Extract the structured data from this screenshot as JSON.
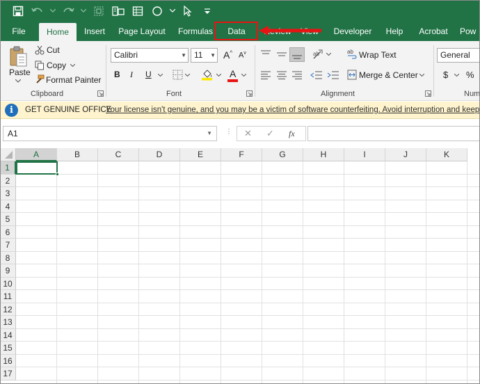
{
  "qat": {
    "icons": [
      "save-icon",
      "undo-icon",
      "redo-icon",
      "select-all-icon",
      "camera-icon",
      "form-icon",
      "shape-icon",
      "select-objects-icon",
      "customize-qat-icon"
    ]
  },
  "tabs": [
    {
      "label": "File"
    },
    {
      "label": "Home"
    },
    {
      "label": "Insert"
    },
    {
      "label": "Page Layout"
    },
    {
      "label": "Formulas"
    },
    {
      "label": "Data"
    },
    {
      "label": "Review"
    },
    {
      "label": "View"
    },
    {
      "label": "Developer"
    },
    {
      "label": "Help"
    },
    {
      "label": "Acrobat"
    },
    {
      "label": "Pow"
    }
  ],
  "active_tab": "Home",
  "highlight_color": "#e81313",
  "accent_color": "#217346",
  "ribbon": {
    "clipboard": {
      "label": "Clipboard",
      "paste": "Paste",
      "cut": "Cut",
      "copy": "Copy",
      "format_painter": "Format Painter"
    },
    "font": {
      "label": "Font",
      "font_name": "Calibri",
      "font_size": "11",
      "bold": "B",
      "italic": "I",
      "underline": "U",
      "grow": "A",
      "shrink": "A",
      "font_color": "A"
    },
    "alignment": {
      "label": "Alignment",
      "wrap_text": "Wrap Text",
      "merge_center": "Merge & Center"
    },
    "number": {
      "label": "Num",
      "format": "General",
      "currency": "$",
      "percent": "%"
    }
  },
  "message_bar": {
    "title": "GET GENUINE OFFICE",
    "text": "Your license isn't genuine, and you may be a victim of software counterfeiting. Avoid interruption and keep your files safe"
  },
  "formula_bar": {
    "name_box": "A1",
    "cancel": "✕",
    "enter": "✓",
    "fx": "fx",
    "formula": ""
  },
  "grid": {
    "columns": [
      "A",
      "B",
      "C",
      "D",
      "E",
      "F",
      "G",
      "H",
      "I",
      "J",
      "K"
    ],
    "rows": [
      "1",
      "2",
      "3",
      "4",
      "5",
      "6",
      "7",
      "8",
      "9",
      "10",
      "11",
      "12",
      "13",
      "14",
      "15",
      "16",
      "17"
    ],
    "active_cell": "A1"
  }
}
